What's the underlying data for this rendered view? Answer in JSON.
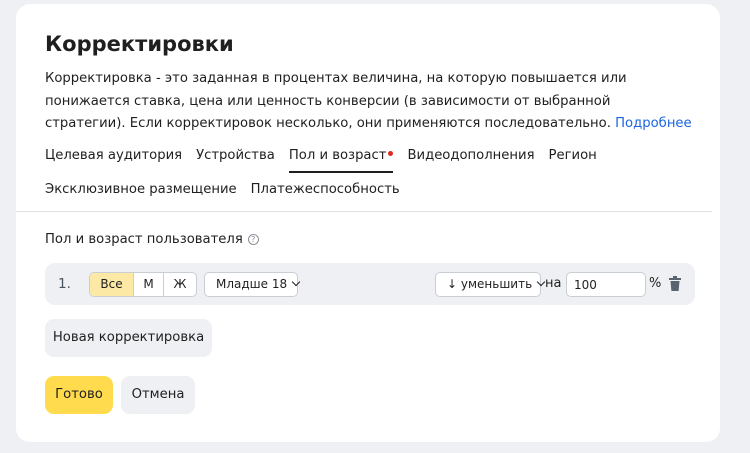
{
  "header": {
    "title": "Корректировки",
    "description": "Корректировка - это заданная в процентах величина, на которую повышается или понижается ставка, цена или ценность конверсии (в зависимости от выбранной стратегии). Если корректировок несколько, они применяются последовательно.",
    "more_link": "Подробнее"
  },
  "tabs": [
    {
      "label": "Целевая аудитория"
    },
    {
      "label": "Устройства"
    },
    {
      "label": "Пол и возраст",
      "active": true,
      "has_dot": true
    },
    {
      "label": "Видеодополнения"
    },
    {
      "label": "Регион"
    },
    {
      "label": "Эксклюзивное размещение"
    },
    {
      "label": "Платежеспособность"
    }
  ],
  "section": {
    "label": "Пол и возраст пользователя",
    "help_icon": "?"
  },
  "rule": {
    "index": "1.",
    "gender_options": [
      "Все",
      "М",
      "Ж"
    ],
    "gender_selected": "Все",
    "age_select": "Младше 18",
    "direction_select": "↓ уменьшить",
    "na_label": "на",
    "value": "100",
    "unit": "%",
    "delete_icon": "trash-icon"
  },
  "buttons": {
    "new_adjustment": "Новая корректировка",
    "done": "Готово",
    "cancel": "Отмена"
  },
  "colors": {
    "accent_yellow": "#ffdb4d",
    "selected_segment": "#fde9a6",
    "link": "#1b66e0",
    "tab_dot": "#e0281f"
  }
}
